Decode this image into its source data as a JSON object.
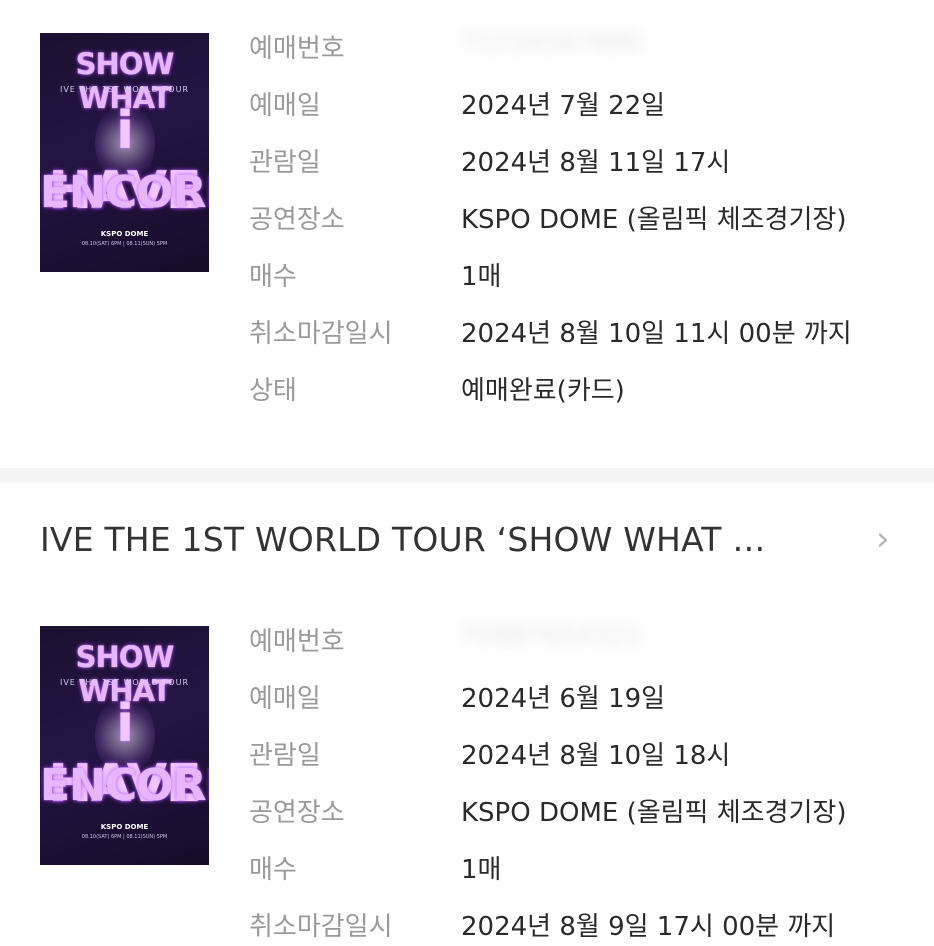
{
  "poster": {
    "line1": "SHOW WHAT",
    "sub": "IVE THE 1ST WORLD TOUR",
    "line2": "i HAVE",
    "line3": "ENCORE",
    "venue": "KSPO DOME",
    "dates": "08.10(SAT) 6PM | 08.11(SUN) 5PM"
  },
  "bookings": [
    {
      "fields": [
        {
          "label": "예매번호",
          "value": "T1234567890"
        },
        {
          "label": "예매일",
          "value": "2024년 7월 22일"
        },
        {
          "label": "관람일",
          "value": "2024년 8월 11일 17시"
        },
        {
          "label": "공연장소",
          "value": "KSPO DOME (올림픽 체조경기장)"
        },
        {
          "label": "매수",
          "value": "1매"
        },
        {
          "label": "취소마감일시",
          "value": "2024년 8월 10일 11시 00분 까지"
        },
        {
          "label": "상태",
          "value": "예매완료(카드)"
        }
      ]
    },
    {
      "fields": [
        {
          "label": "예매번호",
          "value": "T0987654321"
        },
        {
          "label": "예매일",
          "value": "2024년 6월 19일"
        },
        {
          "label": "관람일",
          "value": "2024년 8월 10일 18시"
        },
        {
          "label": "공연장소",
          "value": "KSPO DOME (올림픽 체조경기장)"
        },
        {
          "label": "매수",
          "value": "1매"
        },
        {
          "label": "취소마감일시",
          "value": "2024년 8월 9일 17시 00분 까지"
        }
      ]
    }
  ],
  "second_title": "IVE THE 1ST WORLD TOUR ‘SHOW WHAT …",
  "chevron_icon": "chevron-right-icon"
}
